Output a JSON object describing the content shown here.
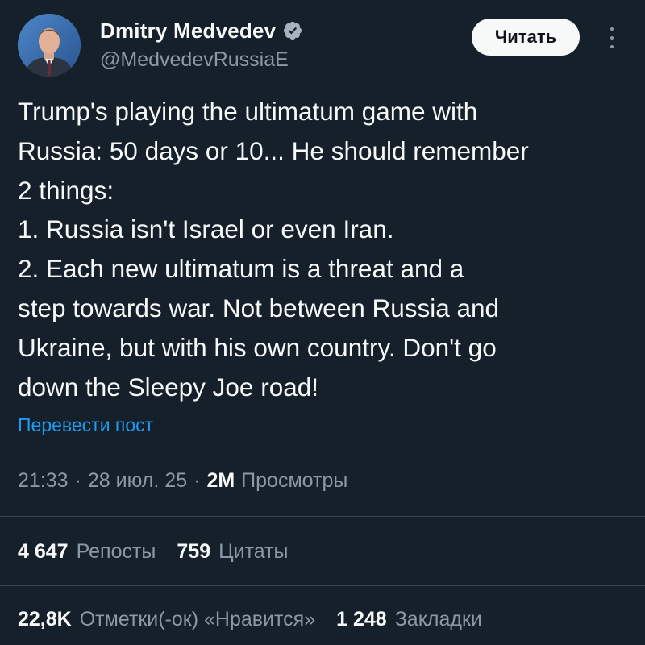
{
  "author": {
    "display_name": "Dmitry Medvedev",
    "handle": "@MedvedevRussiaE",
    "verified": true
  },
  "actions": {
    "follow_label": "Читать"
  },
  "tweet": {
    "text": "Trump's playing the ultimatum game with\nRussia: 50 days or 10... He should remember\n2 things:\n1. Russia isn't Israel or even Iran.\n2. Each new ultimatum is a threat and a\nstep towards war. Not between Russia and\nUkraine, but with his own country. Don't go\ndown the Sleepy Joe road!",
    "translate_label": "Перевести пост"
  },
  "meta": {
    "time": "21:33",
    "separator1": "·",
    "date": "28 июл. 25",
    "separator2": "·",
    "views_count": "2M",
    "views_label": "Просмотры"
  },
  "stats_row1": {
    "reposts_count": "4 647",
    "reposts_label": "Репосты",
    "quotes_count": "759",
    "quotes_label": "Цитаты"
  },
  "stats_row2": {
    "likes_count": "22,8K",
    "likes_label": "Отметки(-ок) «Нравится»",
    "bookmarks_count": "1 248",
    "bookmarks_label": "Закладки"
  },
  "colors": {
    "background": "#15202b",
    "text_primary": "#f7f9f9",
    "text_secondary": "#8b98a5",
    "link": "#1d9bf0",
    "verified_badge": "#a8b2bc",
    "divider": "#38444d"
  },
  "icons": {
    "verified": "verified-badge-icon",
    "more": "more-options-icon"
  }
}
